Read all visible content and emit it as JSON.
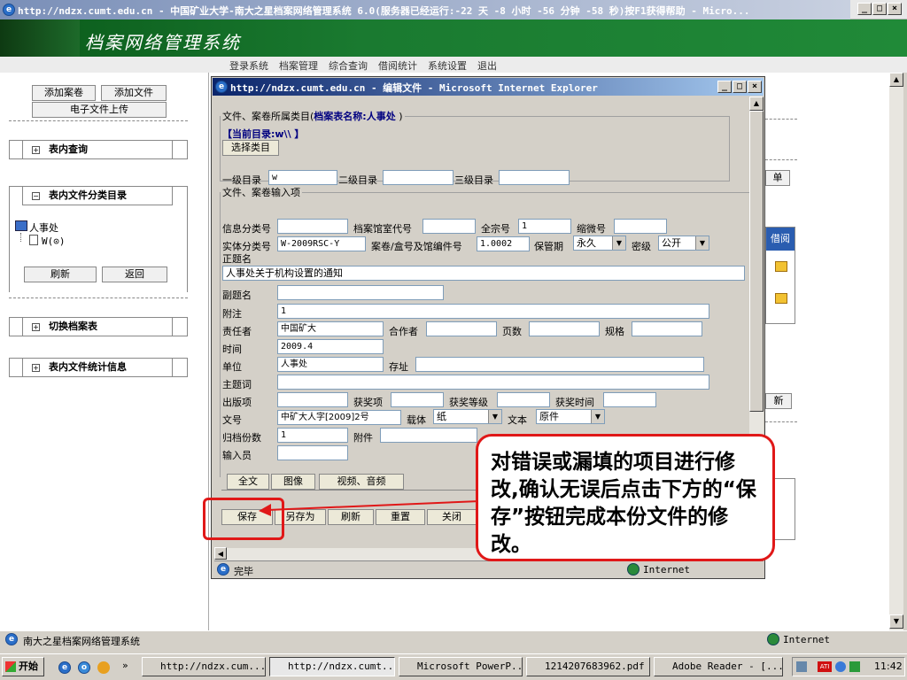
{
  "window": {
    "title": "http://ndzx.cumt.edu.cn - 中国矿业大学-南大之星档案网络管理系统 6.0(服务器已经运行:-22 天 -8 小时 -56 分钟 -58 秒)按F1获得帮助 - Micro..."
  },
  "banner": {
    "title": "档案网络管理系统"
  },
  "topnav": [
    "登录系统",
    "档案管理",
    "综合查询",
    "借阅统计",
    "系统设置",
    "退出"
  ],
  "left": {
    "btn_add_volume": "添加案卷",
    "btn_add_file": "添加文件",
    "btn_upload": "电子文件上传",
    "panel_search": "表内查询",
    "panel_category": "表内文件分类目录",
    "tree_root": "人事处",
    "tree_child": "W(⊙)",
    "btn_refresh": "刷新",
    "btn_back": "返回",
    "panel_switch": "切换档案表",
    "panel_stats": "表内文件统计信息"
  },
  "right_fragments": {
    "list_btn": "单",
    "col_borrow": "借阅",
    "btn_new": "新"
  },
  "dialog": {
    "title": "http://ndzx.cumt.edu.cn - 编辑文件 - Microsoft Internet Explorer",
    "group1_legend": "文件、案卷所属类目(",
    "archive_table": "档案表名称:人事处",
    "group1_legend_end": " )",
    "current_dir": "【当前目录:w\\\\ 】",
    "btn_select_category": "选择类目",
    "level1_label": "一级目录",
    "level1_value": "w",
    "level2_label": "二级目录",
    "level3_label": "三级目录",
    "group2_legend": "文件、案卷输入项",
    "fields": {
      "info_class": "信息分类号",
      "archive_code": "档案馆室代号",
      "fonds_no": "全宗号",
      "fonds_no_value": "1",
      "micro_no": "缩微号",
      "entity_class": "实体分类号",
      "entity_class_value": "W-2009RSC-Y",
      "box_no": "案卷/盒号及馆编件号",
      "box_no_value": "1.0002",
      "retention": "保管期",
      "retention_value": "永久",
      "secret": "密级",
      "secret_value": "公开",
      "main_title": "正题名",
      "main_title_value": "人事处关于机构设置的通知",
      "sub_title": "副题名",
      "note": "附注",
      "note_value": "1",
      "responsible": "责任者",
      "responsible_value": "中国矿大",
      "coauthor": "合作者",
      "pages": "页数",
      "spec": "规格",
      "time": "时间",
      "time_value": "2009.4",
      "unit": "单位",
      "unit_value": "人事处",
      "location": "存址",
      "subject": "主题词",
      "publication": "出版项",
      "award": "获奖项",
      "award_level": "获奖等级",
      "award_time": "获奖时间",
      "doc_no": "文号",
      "doc_no_value": "中矿大人字[2009]2号",
      "carrier": "载体",
      "carrier_value": "纸",
      "text": "文本",
      "text_value": "原件",
      "copies": "归档份数",
      "copies_value": "1",
      "attachment": "附件",
      "operator": "输入员"
    },
    "tabs": [
      "全文",
      "图像",
      "视频、音频"
    ],
    "actions": [
      "保存",
      "另存为",
      "刷新",
      "重置",
      "关闭"
    ],
    "status": "完毕",
    "zone": "Internet"
  },
  "callout": "对错误或漏填的项目进行修改,确认无误后点击下方的“保存”按钮完成本份文件的修改。",
  "main_status": {
    "text": "南大之星档案网络管理系统",
    "zone": "Internet"
  },
  "taskbar": {
    "start": "开始",
    "items": [
      "http://ndzx.cum...",
      "http://ndzx.cumt...",
      "Microsoft PowerP...",
      "1214207683962.pdf",
      "Adobe Reader - [..."
    ],
    "clock": "11:42"
  }
}
